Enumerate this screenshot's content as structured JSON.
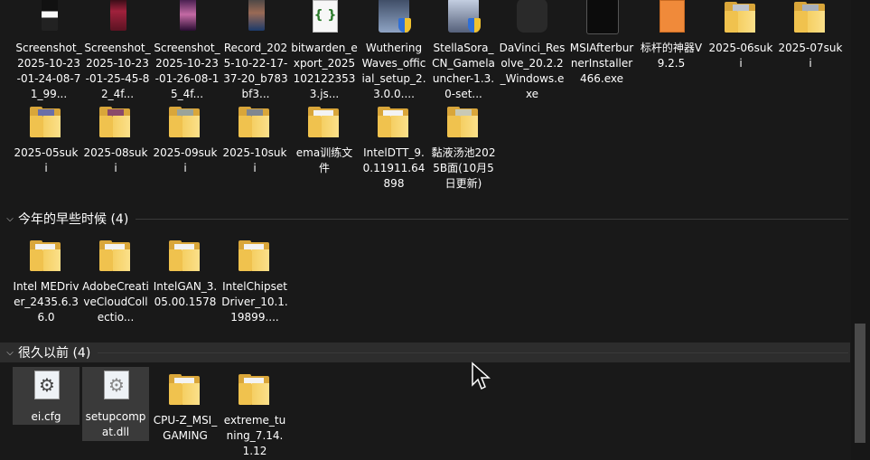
{
  "groups": [
    {
      "title": "今年的早些时候 (4)"
    },
    {
      "title": "很久以前 (4)"
    }
  ],
  "row1": [
    "Screenshot_2025-10-23-01-24-08-71_99...",
    "Screenshot_2025-10-23-01-25-45-82_4f...",
    "Screenshot_2025-10-23-01-26-08-15_4f...",
    "Record_2025-10-22-17-37-20_b783bf3...",
    "bitwarden_export_20251021223533.js...",
    "WutheringWaves_official_setup_2.3.0.0....",
    "StellaSora_CN_Gamelauncher-1.3.0-set...",
    "DaVinci_Resolve_20.2.2_Windows.exe",
    "MSIAfterburnerInstaller466.exe",
    "标杆的神器V9.2.5",
    "2025-06suki",
    "2025-07suki"
  ],
  "row2": [
    "2025-05suki",
    "2025-08suki",
    "2025-09suki",
    "2025-10suki",
    "ema训练文件",
    "IntelDTT_9.0.11911.64898",
    "黏液汤池2025B面(10月5日更新)"
  ],
  "row3": [
    "Intel MEDriver_2435.6.36.0",
    "AdobeCreativeCloudCollectio...",
    "IntelGAN_3.05.00.1578",
    "IntelChipsetDriver_10.1.19899...."
  ],
  "row4": [
    "ei.cfg",
    "setupcompat.dll",
    "CPU-Z_MSI_GAMING",
    "extreme_tuning_7.14.1.12"
  ],
  "colors": {
    "background": "#191919",
    "folder": "#f0c24e",
    "selection": "#3a3a3a"
  }
}
